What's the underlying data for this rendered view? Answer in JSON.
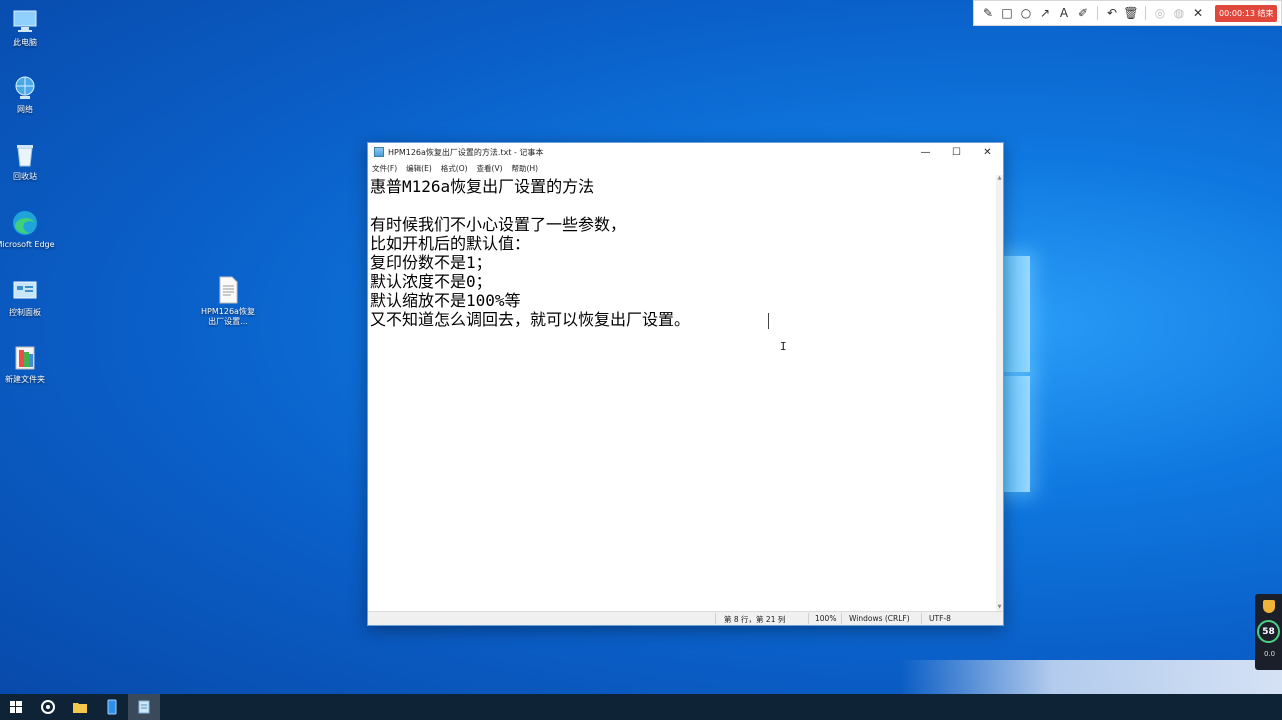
{
  "desktop": {
    "icons": [
      {
        "label": "此电脑",
        "icon": "computer-icon"
      },
      {
        "label": "网络",
        "icon": "network-icon"
      },
      {
        "label": "回收站",
        "icon": "recycle-bin-icon"
      },
      {
        "label": "Microsoft Edge",
        "icon": "edge-icon"
      },
      {
        "label": "控制面板",
        "icon": "control-panel-icon"
      },
      {
        "label": "新建文件夹",
        "icon": "folder-icon"
      },
      {
        "label": "HPM126a恢复出厂设置...",
        "icon": "text-file-icon"
      }
    ]
  },
  "recorder": {
    "tools": [
      "pencil-icon",
      "rectangle-icon",
      "circle-icon",
      "arrow-icon",
      "text-icon",
      "highlighter-icon",
      "undo-icon",
      "trash-icon",
      "eye-off-icon",
      "mic-off-icon",
      "close-icon"
    ],
    "timer": "00:00:13 结束",
    "text_tool_glyph": "A"
  },
  "notepad": {
    "title": "HPM126a恢复出厂设置的方法.txt - 记事本",
    "menu": [
      "文件(F)",
      "编辑(E)",
      "格式(O)",
      "查看(V)",
      "帮助(H)"
    ],
    "lines": [
      "惠普M126a恢复出厂设置的方法",
      "",
      "有时候我们不小心设置了一些参数，",
      "比如开机后的默认值：",
      "复印份数不是1；",
      "默认浓度不是0；",
      "默认缩放不是100%等",
      "又不知道怎么调回去，就可以恢复出厂设置。"
    ],
    "status": {
      "position": "第 8 行，第 21 列",
      "zoom": "100%",
      "line_ending": "Windows (CRLF)",
      "encoding": "UTF-8"
    },
    "window_buttons": {
      "minimize": "—",
      "maximize": "☐",
      "close": "✕"
    }
  },
  "widget": {
    "value": "58",
    "small": "0.0"
  },
  "colors": {
    "desktop_bg": "#0a5fc8",
    "taskbar": "#0f2336",
    "timer_bg": "#e0483b"
  }
}
